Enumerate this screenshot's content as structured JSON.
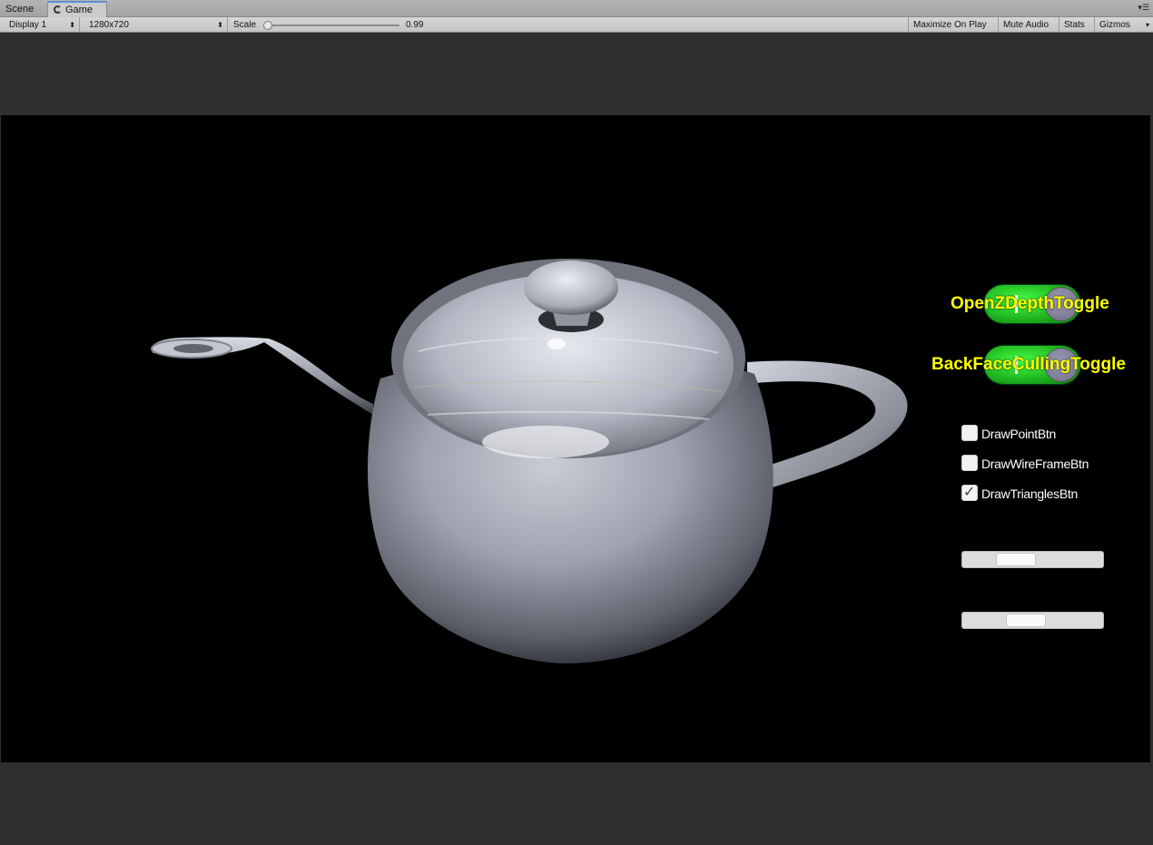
{
  "tabs": [
    {
      "label": "Scene",
      "active": false
    },
    {
      "label": "Game",
      "active": true
    }
  ],
  "toolbar": {
    "display": "Display 1",
    "resolution": "1280x720",
    "scale_label": "Scale",
    "scale_value": "0.99",
    "maximize_on_play": "Maximize On Play",
    "mute_audio": "Mute Audio",
    "stats": "Stats",
    "gizmos": "Gizmos"
  },
  "overlay": {
    "toggles": [
      {
        "label": "OpenZDepthToggle",
        "on": true
      },
      {
        "label": "BackFaceCullingToggle",
        "on": true
      }
    ],
    "checkboxes": [
      {
        "label": "DrawPointBtn",
        "checked": false
      },
      {
        "label": "DrawWireFrameBtn",
        "checked": false
      },
      {
        "label": "DrawTrianglesBtn",
        "checked": true
      }
    ],
    "sliders": [
      {
        "value": 0.4
      },
      {
        "value": 0.46
      }
    ]
  },
  "icons": {
    "game_tab": "camera-icon",
    "tab_menu": "tab-menu-icon",
    "dropdown": "dropdown-arrow-icon",
    "check": "checkmark-icon"
  }
}
